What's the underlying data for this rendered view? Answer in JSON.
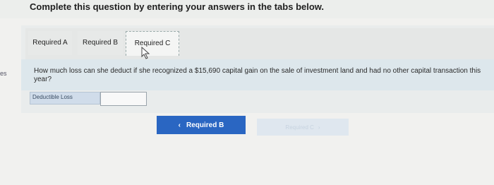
{
  "header": {
    "instruction": "Complete this question by entering your answers in the tabs below."
  },
  "left_edge": {
    "text": "es"
  },
  "tabs": [
    {
      "label": "Required A"
    },
    {
      "label": "Required B"
    },
    {
      "label": "Required C"
    }
  ],
  "question": {
    "text": "How much loss can she deduct if she recognized a $15,690 capital gain on the sale of investment land and had no other capital transaction this year?"
  },
  "form": {
    "field_label": "Deductible Loss",
    "field_value": ""
  },
  "navigation": {
    "prev_label": "Required B",
    "prev_icon": "‹",
    "next_label": "Required C",
    "next_icon": "›"
  }
}
